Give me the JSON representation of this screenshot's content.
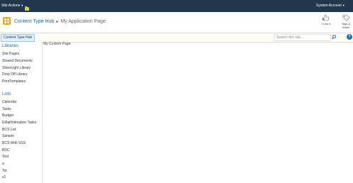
{
  "top_bar": {
    "site_actions": "Site Actions",
    "system_account": "System Account"
  },
  "header": {
    "site_title": "Content Type Hub",
    "separator": "▸",
    "page_title": "My Application Page",
    "like_label": "I Like It",
    "tags_label": "Tags &",
    "notes_label": "Notes"
  },
  "topnav": {
    "tab": "Content Type Hub",
    "search_placeholder": "Search this site..."
  },
  "quicklaunch": {
    "libraries_heading": "Libraries",
    "libraries": [
      "Site Pages",
      "Shared Documents",
      "SilverLight Library",
      "Drop Off Library",
      "PrintTemplates"
    ],
    "lists_heading": "Lists",
    "lists": [
      "Calendar",
      "Tasks",
      "Budget",
      "EMailIntimation Tasks",
      "BCS List",
      "Sample",
      "BCS With SSS",
      "BDC",
      "Test",
      "a",
      "Tst",
      "s1"
    ]
  },
  "main": {
    "content": "My Custom Page"
  },
  "colors": {
    "top_bar": "#21374c",
    "link": "#0072bc",
    "logo": "#f2a81e"
  }
}
